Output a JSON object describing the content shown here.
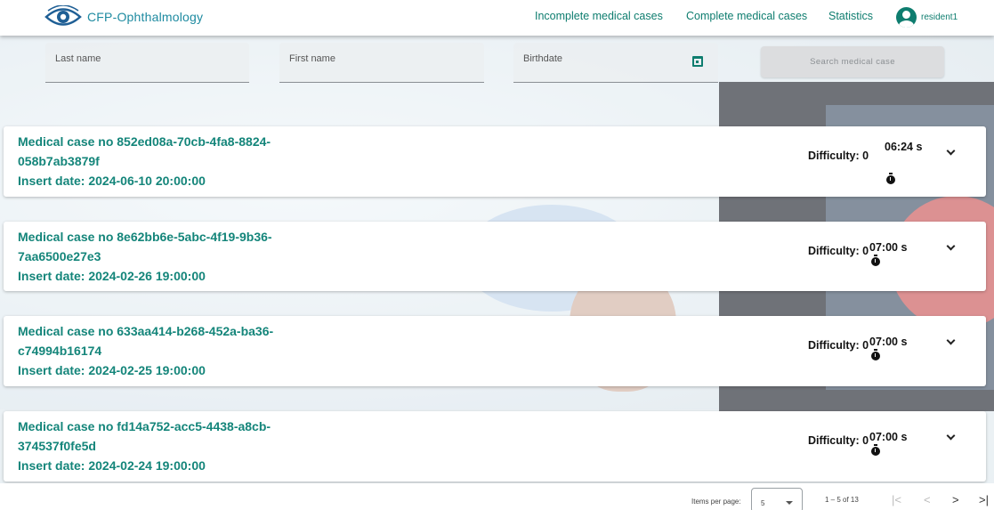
{
  "header": {
    "brand": "CFP-Ophthalmology",
    "nav": [
      "Incomplete medical cases",
      "Complete medical cases",
      "Statistics"
    ],
    "user": "resident1"
  },
  "search": {
    "last_name_label": "Last name",
    "first_name_label": "First name",
    "birthdate_label": "Birthdate",
    "button": "Search medical case"
  },
  "cases": [
    {
      "line1": "Medical case no 852ed08a-70cb-4fa8-8824-",
      "line2": "058b7ab3879f",
      "insert": "Insert date: 2024-06-10 20:00:00",
      "difficulty": "Difficulty: 0",
      "time": "06:24 s"
    },
    {
      "line1": "Medical case no 8e62bb6e-5abc-4f19-9b36-",
      "line2": "7aa6500e27e3",
      "insert": "Insert date: 2024-02-26 19:00:00",
      "difficulty": "Difficulty: 0",
      "time": "07:00 s"
    },
    {
      "line1": "Medical case no 633aa414-b268-452a-ba36-",
      "line2": "c74994b16174",
      "insert": "Insert date: 2024-02-25 19:00:00",
      "difficulty": "Difficulty: 0",
      "time": "07:00 s"
    },
    {
      "line1": "Medical case no fd14a752-acc5-4438-a8cb-",
      "line2": "374537f0fe5d",
      "insert": "Insert date: 2024-02-24 19:00:00",
      "difficulty": "Difficulty: 0",
      "time": "07:00 s"
    }
  ],
  "paginator": {
    "items_label": "Items per page:",
    "page_size": "5",
    "range": "1 – 5 of 13",
    "first": "|<",
    "prev": "<",
    "next": ">",
    "last": ">|"
  }
}
